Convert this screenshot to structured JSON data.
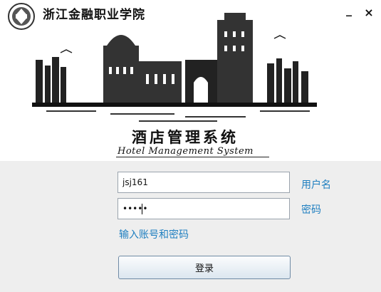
{
  "header": {
    "school_name": "浙江金融职业学院",
    "minimize_glyph": "_",
    "close_glyph": "×"
  },
  "banner": {
    "title_cn": "酒店管理系统",
    "title_en": "Hotel Management System"
  },
  "login": {
    "username_value": "jsj161",
    "password_value": "•••••",
    "username_label": "用户名",
    "password_label": "密码",
    "hint": "输入账号和密码",
    "login_button": "登录"
  },
  "colors": {
    "accent": "#1f7fc0",
    "form_bg": "#eeeeee"
  },
  "icons": {
    "logo": "school-logo",
    "minimize": "minimize-icon",
    "close": "close-icon"
  }
}
